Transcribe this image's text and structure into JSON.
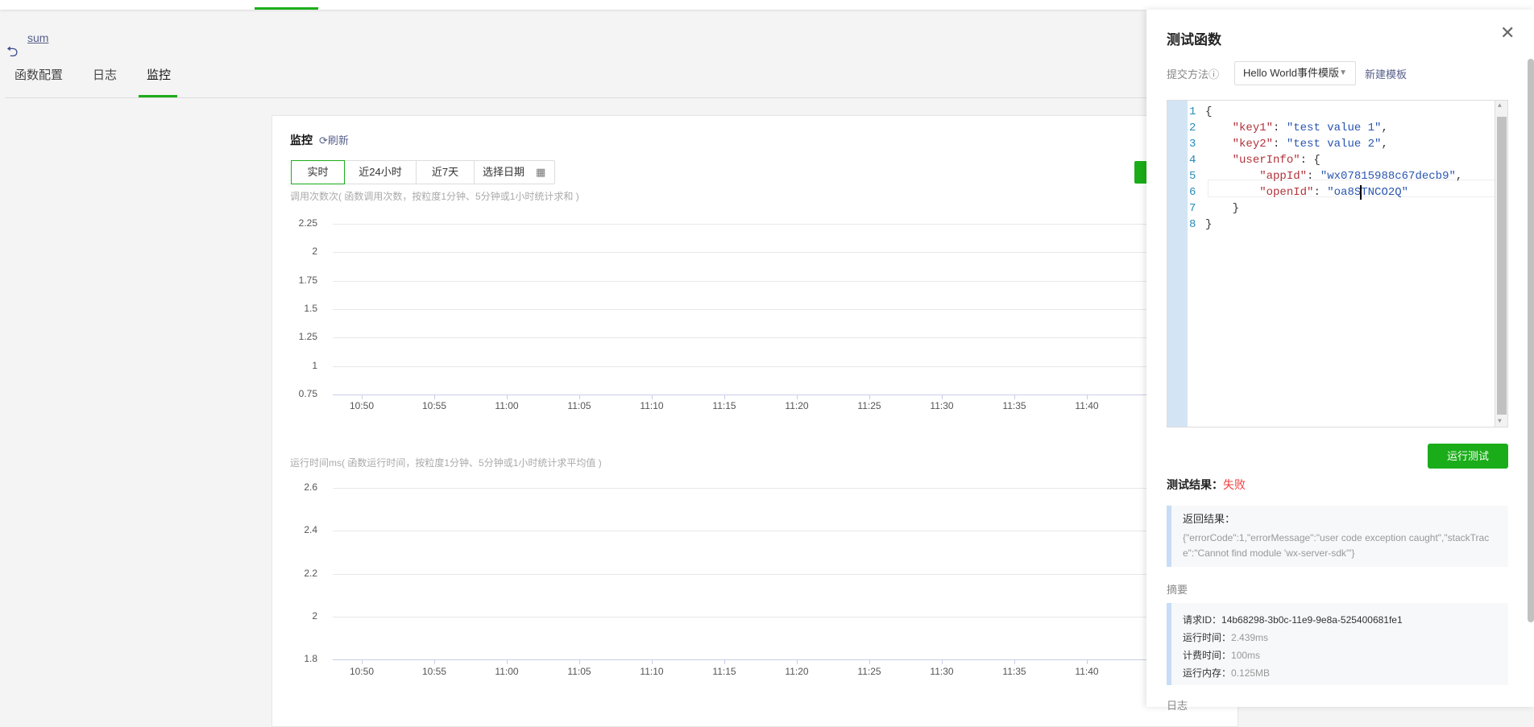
{
  "breadcrumb": {
    "back_label": "sum"
  },
  "tabs": [
    {
      "label": "函数配置"
    },
    {
      "label": "日志"
    },
    {
      "label": "监控",
      "active": true
    }
  ],
  "monitor": {
    "title": "监控",
    "refresh": "刷新",
    "ranges": [
      "实时",
      "近24小时",
      "近7天",
      "选择日期"
    ],
    "selected_range": "实时"
  },
  "chart_data": [
    {
      "type": "line",
      "title": "调用次数",
      "unit": "次",
      "subtitle": "( 函数调用次数，按粒度1分钟、5分钟或1小时统计求和 )",
      "y_ticks": [
        "2.25",
        "2",
        "1.75",
        "1.5",
        "1.25",
        "1",
        "0.75"
      ],
      "ylim": [
        0.75,
        2.25
      ],
      "x_ticks": [
        "10:50",
        "10:55",
        "11:00",
        "11:05",
        "11:10",
        "11:15",
        "11:20",
        "11:25",
        "11:30",
        "11:35",
        "11:40"
      ],
      "series": [],
      "grid": true
    },
    {
      "type": "line",
      "title": "运行时间",
      "unit": "ms",
      "subtitle": "( 函数运行时间，按粒度1分钟、5分钟或1小时统计求平均值 )",
      "y_ticks": [
        "2.6",
        "2.4",
        "2.2",
        "2",
        "1.8"
      ],
      "ylim": [
        1.8,
        2.6
      ],
      "x_ticks": [
        "10:50",
        "10:55",
        "11:00",
        "11:05",
        "11:10",
        "11:15",
        "11:20",
        "11:25",
        "11:30",
        "11:35",
        "11:40"
      ],
      "series": [],
      "grid": true
    }
  ],
  "panel": {
    "title": "测试函数",
    "close": "✕",
    "submit_label": "提交方法",
    "info_icon": "ⓘ",
    "template_value": "Hello World事件模版",
    "new_template": "新建模板",
    "code": [
      {
        "n": "1",
        "parts": [
          [
            "p",
            "{"
          ]
        ]
      },
      {
        "n": "2",
        "parts": [
          [
            "p",
            "    "
          ],
          [
            "k",
            "\"key1\""
          ],
          [
            "p",
            ": "
          ],
          [
            "s",
            "\"test value 1\""
          ],
          [
            "p",
            ","
          ]
        ]
      },
      {
        "n": "3",
        "parts": [
          [
            "p",
            "    "
          ],
          [
            "k",
            "\"key2\""
          ],
          [
            "p",
            ": "
          ],
          [
            "s",
            "\"test value 2\""
          ],
          [
            "p",
            ","
          ]
        ]
      },
      {
        "n": "4",
        "parts": [
          [
            "p",
            "    "
          ],
          [
            "k",
            "\"userInfo\""
          ],
          [
            "p",
            ": {"
          ]
        ]
      },
      {
        "n": "5",
        "parts": [
          [
            "p",
            "        "
          ],
          [
            "k",
            "\"appId\""
          ],
          [
            "p",
            ": "
          ],
          [
            "s",
            "\"wx07815988c67decb9\""
          ],
          [
            "p",
            ","
          ]
        ]
      },
      {
        "n": "6",
        "parts": [
          [
            "p",
            "        "
          ],
          [
            "k",
            "\"openId\""
          ],
          [
            "p",
            ": "
          ],
          [
            "s",
            "\"oa8STNCO2Q\""
          ]
        ]
      },
      {
        "n": "7",
        "parts": [
          [
            "p",
            "    }"
          ]
        ]
      },
      {
        "n": "8",
        "parts": [
          [
            "p",
            "}"
          ]
        ]
      }
    ],
    "run_button": "运行测试",
    "result_label": "测试结果：",
    "result_status": "失败",
    "status_color": "#f23c3c",
    "return_label": "返回结果：",
    "return_value": "{\"errorCode\":1,\"errorMessage\":\"user code exception caught\",\"stackTrace\":\"Cannot find module 'wx-server-sdk'\"}",
    "summary_title": "摘要",
    "summary": [
      {
        "label": "请求ID：",
        "value": "14b68298-3b0c-11e9-9e8a-525400681fe1"
      },
      {
        "label": "运行时间：",
        "value": "2.439ms"
      },
      {
        "label": "计费时间：",
        "value": "100ms"
      },
      {
        "label": "运行内存：",
        "value": "0.125MB"
      }
    ],
    "log_title": "日志"
  },
  "colors": {
    "accent": "#1aad19",
    "link": "#57608a",
    "error": "#f23c3c"
  }
}
